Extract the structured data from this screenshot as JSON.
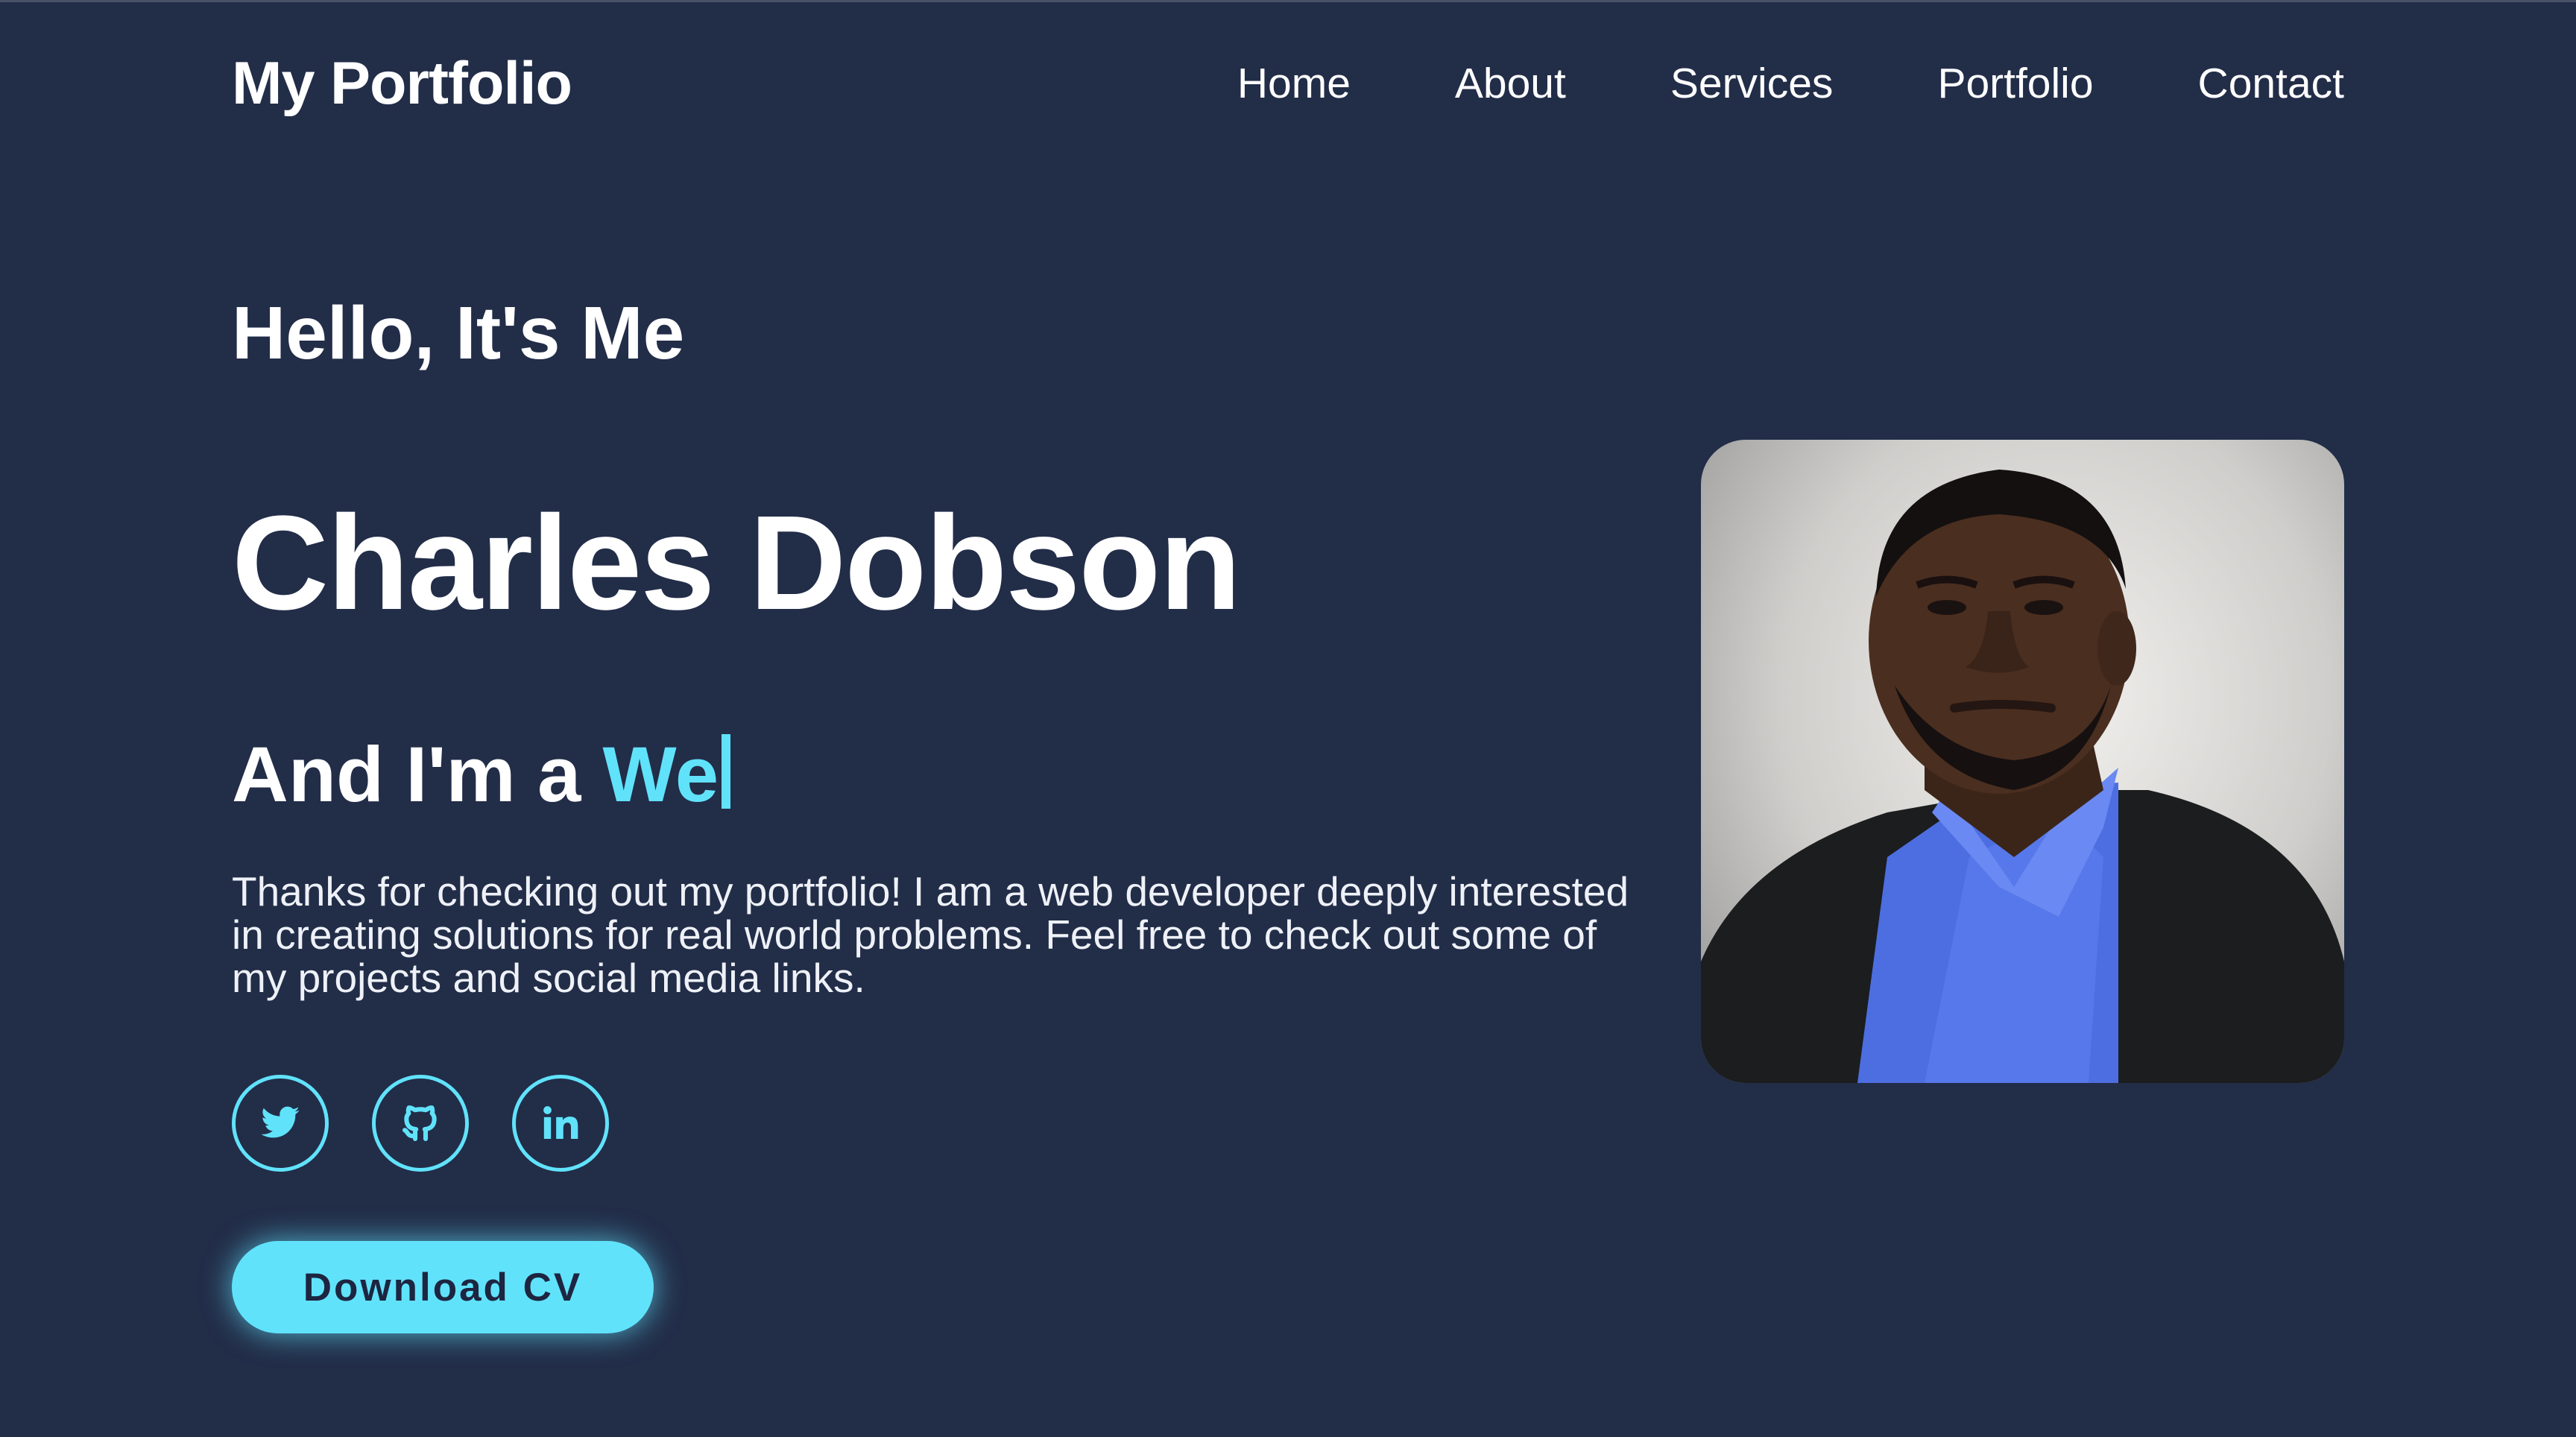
{
  "header": {
    "logo": "My Portfolio",
    "nav": [
      "Home",
      "About",
      "Services",
      "Portfolio",
      "Contact"
    ]
  },
  "hero": {
    "greeting": "Hello, It's Me",
    "name": "Charles Dobson",
    "role_prefix": "And I'm a ",
    "role_typed": "We",
    "description": "Thanks for checking out my portfolio! I am a web developer deeply interested in creating solutions for real world problems. Feel free to check out some of my projects and social media links.",
    "socials": [
      {
        "icon": "twitter-icon"
      },
      {
        "icon": "github-icon"
      },
      {
        "icon": "linkedin-icon"
      }
    ],
    "download_label": "Download CV",
    "photo_alt": "Charles Dobson"
  },
  "colors": {
    "background": "#222d48",
    "accent": "#61e2fb",
    "text": "#ffffff",
    "button_text": "#1d2540"
  }
}
